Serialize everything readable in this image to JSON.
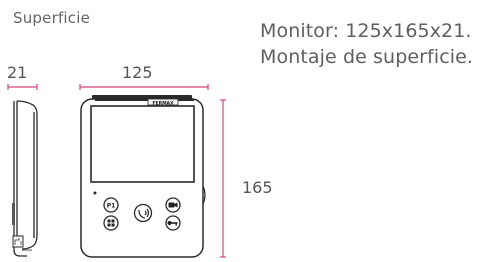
{
  "caption": "Superficie",
  "description": {
    "line1": "Monitor: 125x165x21.",
    "line2": "Montaje de superficie."
  },
  "dimensions": {
    "depth": "21",
    "width": "125",
    "height": "165"
  },
  "device": {
    "brand_plate": "FERMAX",
    "button_labels": [
      "P1",
      "",
      "",
      "",
      ""
    ]
  },
  "colors": {
    "dimension_line": "#d3457e",
    "outline": "#2a2a2a"
  }
}
